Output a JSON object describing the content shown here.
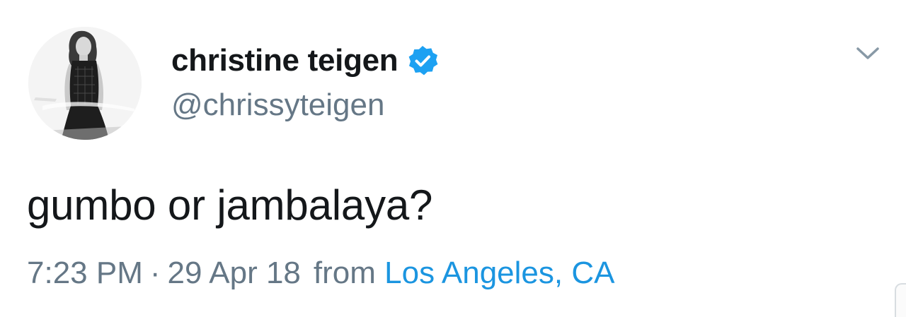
{
  "user": {
    "display_name": "christine teigen",
    "handle": "@chrissyteigen",
    "verified": true
  },
  "tweet": {
    "text": "gumbo or jambalaya?",
    "time": "7:23 PM",
    "separator": "·",
    "date": "29 Apr 18",
    "from_label": "from",
    "location": "Los Angeles, CA"
  },
  "icons": {
    "verified": "verified-badge-icon",
    "menu": "chevron-down-icon"
  },
  "colors": {
    "text_primary": "#14171a",
    "text_secondary": "#657786",
    "link": "#1b95e0",
    "verified": "#1da1f2"
  }
}
